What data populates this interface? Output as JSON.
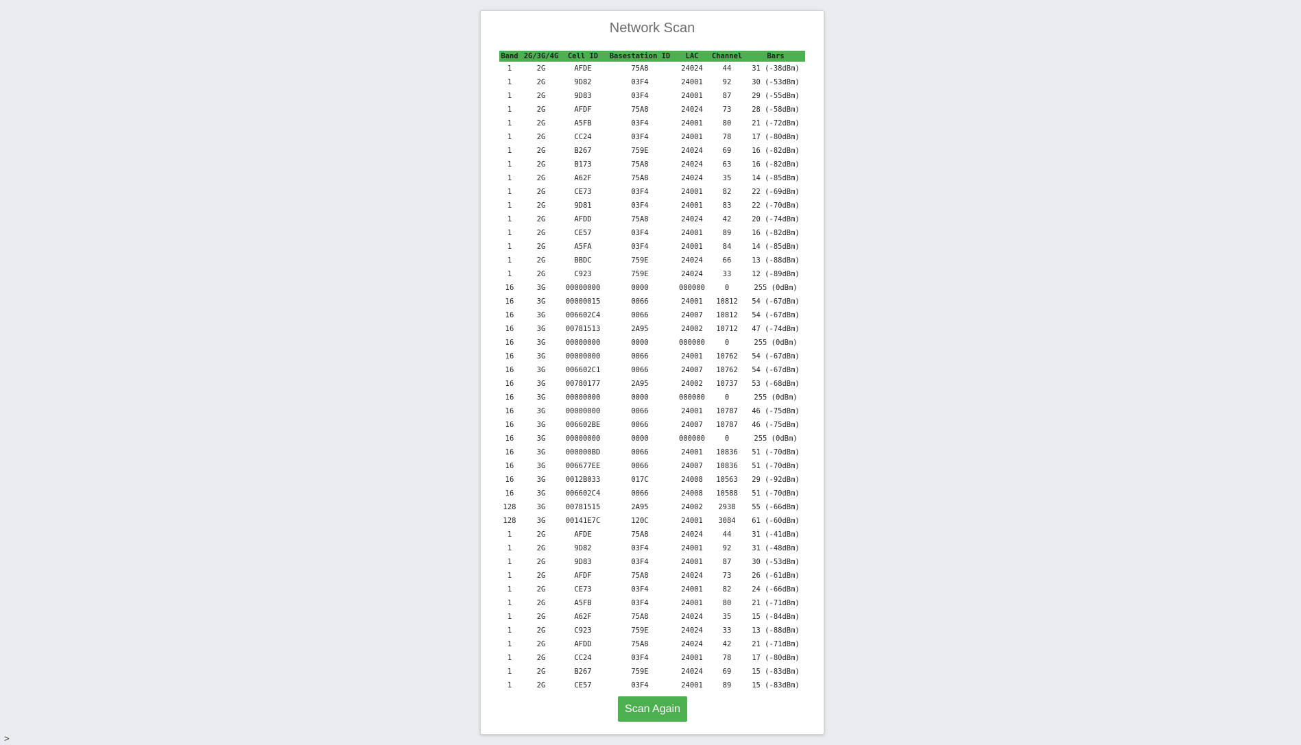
{
  "page": {
    "title": "Network Scan",
    "scan_button_label": "Scan Again",
    "prompt_char": ">",
    "colors": {
      "background": "#e9ebee",
      "header_green": "#4caf50",
      "button_green": "#4caf50"
    }
  },
  "table": {
    "headers": [
      "Band",
      "2G/3G/4G",
      "Cell ID",
      "Basestation ID",
      "LAC",
      "Channel",
      "Bars"
    ],
    "rows": [
      [
        "1",
        "2G",
        "AFDE",
        "75A8",
        "24024",
        "44",
        "31 (-38dBm)"
      ],
      [
        "1",
        "2G",
        "9D82",
        "03F4",
        "24001",
        "92",
        "30 (-53dBm)"
      ],
      [
        "1",
        "2G",
        "9D83",
        "03F4",
        "24001",
        "87",
        "29 (-55dBm)"
      ],
      [
        "1",
        "2G",
        "AFDF",
        "75A8",
        "24024",
        "73",
        "28 (-58dBm)"
      ],
      [
        "1",
        "2G",
        "A5FB",
        "03F4",
        "24001",
        "80",
        "21 (-72dBm)"
      ],
      [
        "1",
        "2G",
        "CC24",
        "03F4",
        "24001",
        "78",
        "17 (-80dBm)"
      ],
      [
        "1",
        "2G",
        "B267",
        "759E",
        "24024",
        "69",
        "16 (-82dBm)"
      ],
      [
        "1",
        "2G",
        "B173",
        "75A8",
        "24024",
        "63",
        "16 (-82dBm)"
      ],
      [
        "1",
        "2G",
        "A62F",
        "75A8",
        "24024",
        "35",
        "14 (-85dBm)"
      ],
      [
        "1",
        "2G",
        "CE73",
        "03F4",
        "24001",
        "82",
        "22 (-69dBm)"
      ],
      [
        "1",
        "2G",
        "9D81",
        "03F4",
        "24001",
        "83",
        "22 (-70dBm)"
      ],
      [
        "1",
        "2G",
        "AFDD",
        "75A8",
        "24024",
        "42",
        "20 (-74dBm)"
      ],
      [
        "1",
        "2G",
        "CE57",
        "03F4",
        "24001",
        "89",
        "16 (-82dBm)"
      ],
      [
        "1",
        "2G",
        "A5FA",
        "03F4",
        "24001",
        "84",
        "14 (-85dBm)"
      ],
      [
        "1",
        "2G",
        "BBDC",
        "759E",
        "24024",
        "66",
        "13 (-88dBm)"
      ],
      [
        "1",
        "2G",
        "C923",
        "759E",
        "24024",
        "33",
        "12 (-89dBm)"
      ],
      [
        "16",
        "3G",
        "00000000",
        "0000",
        "000000",
        "0",
        "255 (0dBm)"
      ],
      [
        "16",
        "3G",
        "00000015",
        "0066",
        "24001",
        "10812",
        "54 (-67dBm)"
      ],
      [
        "16",
        "3G",
        "006602C4",
        "0066",
        "24007",
        "10812",
        "54 (-67dBm)"
      ],
      [
        "16",
        "3G",
        "00781513",
        "2A95",
        "24002",
        "10712",
        "47 (-74dBm)"
      ],
      [
        "16",
        "3G",
        "00000000",
        "0000",
        "000000",
        "0",
        "255 (0dBm)"
      ],
      [
        "16",
        "3G",
        "00000000",
        "0066",
        "24001",
        "10762",
        "54 (-67dBm)"
      ],
      [
        "16",
        "3G",
        "006602C1",
        "0066",
        "24007",
        "10762",
        "54 (-67dBm)"
      ],
      [
        "16",
        "3G",
        "00780177",
        "2A95",
        "24002",
        "10737",
        "53 (-68dBm)"
      ],
      [
        "16",
        "3G",
        "00000000",
        "0000",
        "000000",
        "0",
        "255 (0dBm)"
      ],
      [
        "16",
        "3G",
        "00000000",
        "0066",
        "24001",
        "10787",
        "46 (-75dBm)"
      ],
      [
        "16",
        "3G",
        "006602BE",
        "0066",
        "24007",
        "10787",
        "46 (-75dBm)"
      ],
      [
        "16",
        "3G",
        "00000000",
        "0000",
        "000000",
        "0",
        "255 (0dBm)"
      ],
      [
        "16",
        "3G",
        "000000BD",
        "0066",
        "24001",
        "10836",
        "51 (-70dBm)"
      ],
      [
        "16",
        "3G",
        "006677EE",
        "0066",
        "24007",
        "10836",
        "51 (-70dBm)"
      ],
      [
        "16",
        "3G",
        "0012B033",
        "017C",
        "24008",
        "10563",
        "29 (-92dBm)"
      ],
      [
        "16",
        "3G",
        "006602C4",
        "0066",
        "24008",
        "10588",
        "51 (-70dBm)"
      ],
      [
        "128",
        "3G",
        "00781515",
        "2A95",
        "24002",
        "2938",
        "55 (-66dBm)"
      ],
      [
        "128",
        "3G",
        "00141E7C",
        "120C",
        "24001",
        "3084",
        "61 (-60dBm)"
      ],
      [
        "1",
        "2G",
        "AFDE",
        "75A8",
        "24024",
        "44",
        "31 (-41dBm)"
      ],
      [
        "1",
        "2G",
        "9D82",
        "03F4",
        "24001",
        "92",
        "31 (-48dBm)"
      ],
      [
        "1",
        "2G",
        "9D83",
        "03F4",
        "24001",
        "87",
        "30 (-53dBm)"
      ],
      [
        "1",
        "2G",
        "AFDF",
        "75A8",
        "24024",
        "73",
        "26 (-61dBm)"
      ],
      [
        "1",
        "2G",
        "CE73",
        "03F4",
        "24001",
        "82",
        "24 (-66dBm)"
      ],
      [
        "1",
        "2G",
        "A5FB",
        "03F4",
        "24001",
        "80",
        "21 (-71dBm)"
      ],
      [
        "1",
        "2G",
        "A62F",
        "75A8",
        "24024",
        "35",
        "15 (-84dBm)"
      ],
      [
        "1",
        "2G",
        "C923",
        "759E",
        "24024",
        "33",
        "13 (-88dBm)"
      ],
      [
        "1",
        "2G",
        "AFDD",
        "75A8",
        "24024",
        "42",
        "21 (-71dBm)"
      ],
      [
        "1",
        "2G",
        "CC24",
        "03F4",
        "24001",
        "78",
        "17 (-80dBm)"
      ],
      [
        "1",
        "2G",
        "B267",
        "759E",
        "24024",
        "69",
        "15 (-83dBm)"
      ],
      [
        "1",
        "2G",
        "CE57",
        "03F4",
        "24001",
        "89",
        "15 (-83dBm)"
      ]
    ]
  }
}
